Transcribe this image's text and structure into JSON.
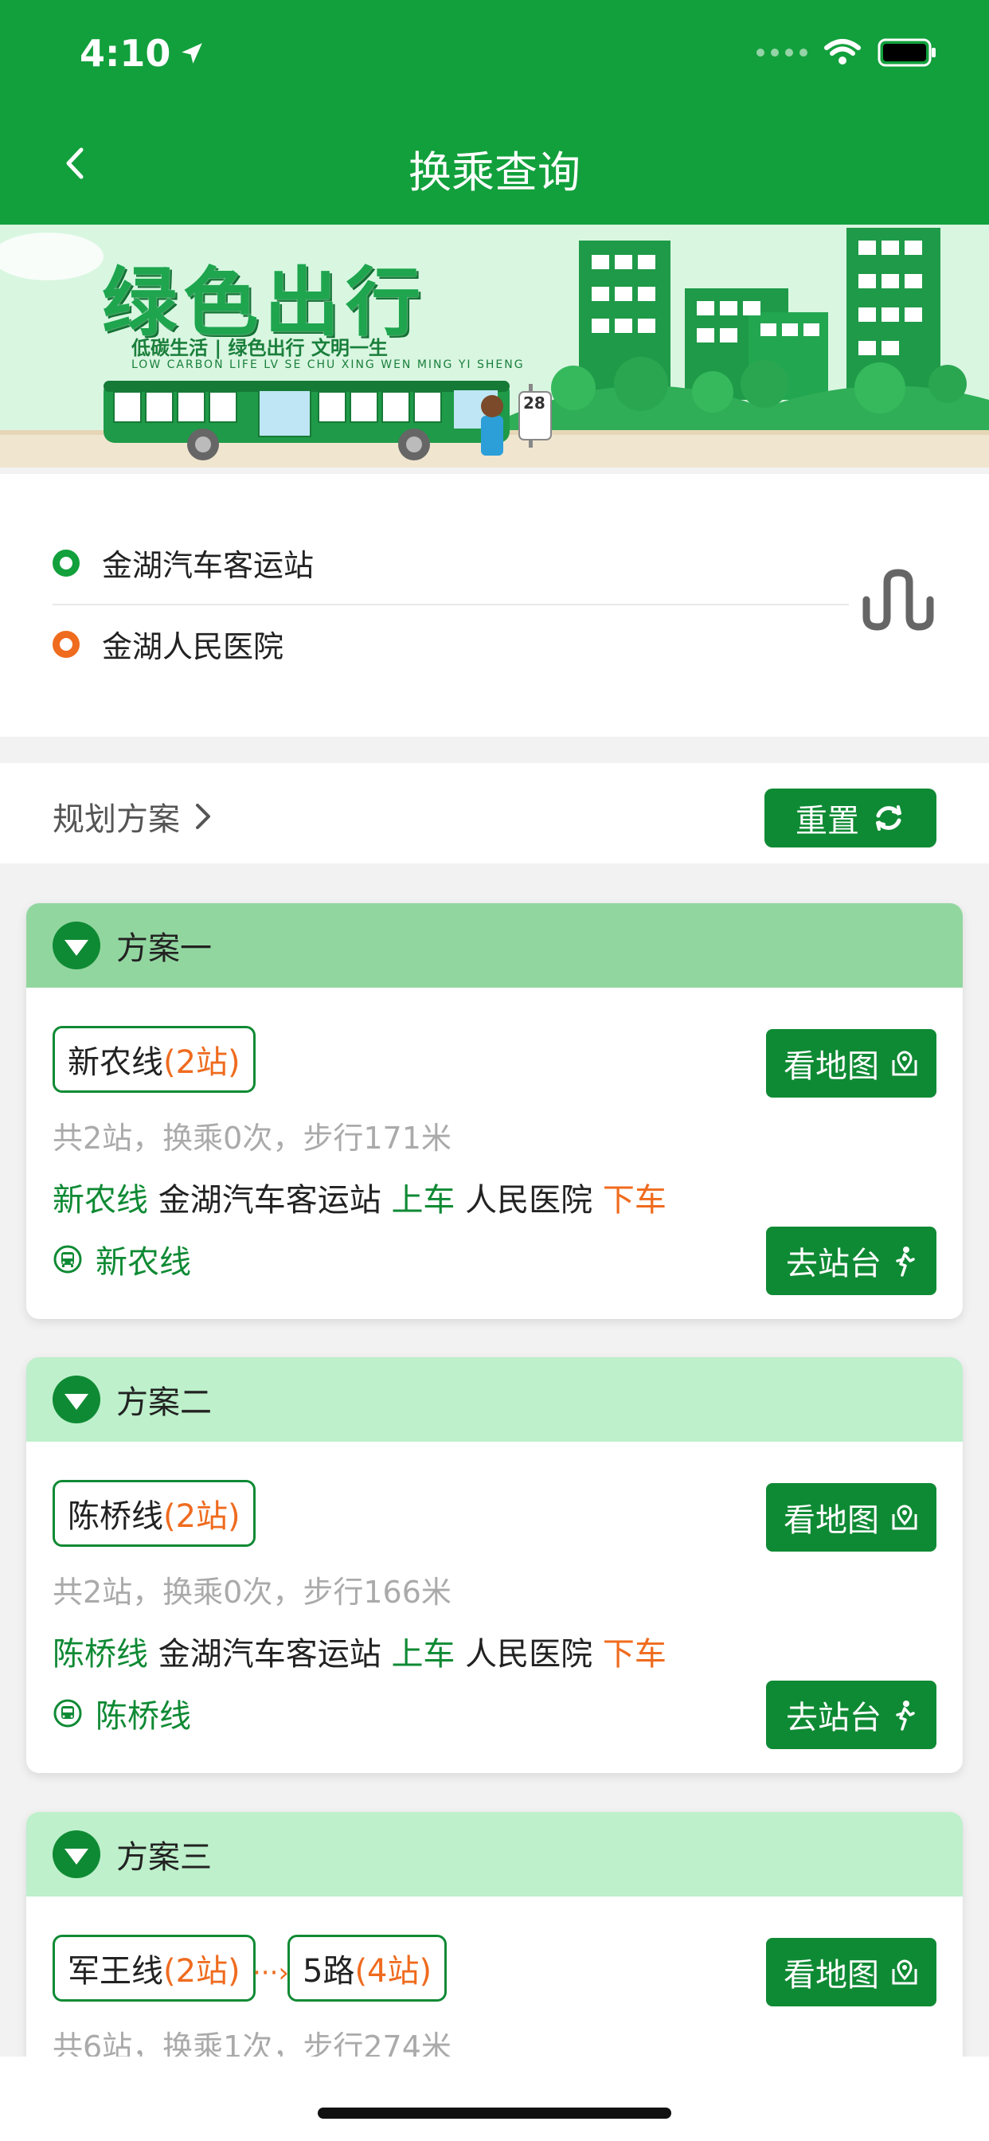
{
  "status_bar": {
    "time": "4:10"
  },
  "header": {
    "title": "换乘查询"
  },
  "route": {
    "origin": "金湖汽车客运站",
    "destination": "金湖人民医院"
  },
  "plan_bar": {
    "link_label": "规划方案",
    "reset_label": "重置"
  },
  "buttons": {
    "view_map": "看地图",
    "go_station": "去站台"
  },
  "plans": [
    {
      "name": "方案一",
      "tags": [
        {
          "line": "新农线",
          "stops": "(2站)"
        }
      ],
      "summary": "共2站，换乘0次，步行171米",
      "detail": {
        "line": "新农线",
        "board_station": "金湖汽车客运站",
        "board": "上车",
        "alight_station": "人民医院",
        "alight": "下车"
      },
      "bus": "新农线"
    },
    {
      "name": "方案二",
      "tags": [
        {
          "line": "陈桥线",
          "stops": "(2站)"
        }
      ],
      "summary": "共2站，换乘0次，步行166米",
      "detail": {
        "line": "陈桥线",
        "board_station": "金湖汽车客运站",
        "board": "上车",
        "alight_station": "人民医院",
        "alight": "下车"
      },
      "bus": "陈桥线"
    },
    {
      "name": "方案三",
      "tags": [
        {
          "line": "军王线",
          "stops": "(2站)"
        },
        {
          "line": "5路",
          "stops": "(4站)"
        }
      ],
      "summary": "共6站，换乘1次，步行274米"
    }
  ],
  "banner": {
    "title": "绿色出行",
    "slogan": "低碳生活 | 绿色出行 文明一生",
    "slogan_en": "LOW CARBON LIFE   LV SE CHU XING  WEN MING YI SHENG",
    "bus_stop_number": "28"
  },
  "colors": {
    "primary": "#12a03c",
    "dark_green": "#0f8a34",
    "orange": "#ef6b1e",
    "head1": "#92d69f",
    "head2": "#bdf0cb"
  }
}
